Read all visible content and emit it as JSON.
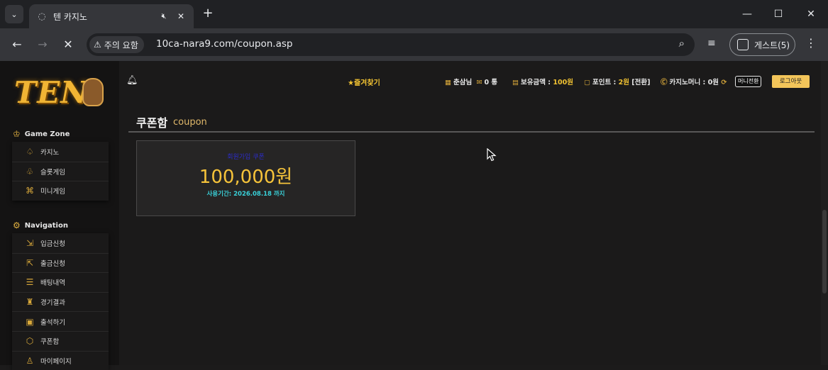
{
  "browser": {
    "tab_title": "텐 카지노",
    "url": "10ca-nara9.com/coupon.asp",
    "security_label": "주의 요함",
    "profile_label": "게스트(5)"
  },
  "sidebar": {
    "logo_text": "TEN",
    "game_zone_title": "Game Zone",
    "game_zone_items": [
      {
        "label": "카지노",
        "icon": "spade-icon"
      },
      {
        "label": "슬롯게임",
        "icon": "cherry-icon"
      },
      {
        "label": "미니게임",
        "icon": "gamepad-icon"
      }
    ],
    "navigation_title": "Navigation",
    "navigation_items": [
      {
        "label": "입금신청",
        "icon": "deposit-icon"
      },
      {
        "label": "출금신청",
        "icon": "withdraw-icon"
      },
      {
        "label": "배팅내역",
        "icon": "bet-history-icon"
      },
      {
        "label": "경기결과",
        "icon": "results-icon"
      },
      {
        "label": "출석하기",
        "icon": "attendance-icon"
      },
      {
        "label": "쿠폰함",
        "icon": "coupon-icon"
      },
      {
        "label": "마이페이지",
        "icon": "user-icon"
      }
    ]
  },
  "topbar": {
    "favorite": "★즐겨찾기",
    "user_name": "춘삼님",
    "messages": "0 통",
    "balance_label": "보유금액 :",
    "balance_value": "100원",
    "point_label": "포인트 :",
    "point_value": "2원",
    "point_convert": "[전환]",
    "casino_money_label": "카지노머니 :",
    "casino_money_value": "0원",
    "mini_convert": "머니전환",
    "logout": "로그아웃"
  },
  "main": {
    "title": "쿠폰함",
    "subtitle": "coupon",
    "coupon": {
      "name": "회원가입 쿠폰",
      "amount": "100,000원",
      "period": "사용기간: 2026.08.18 까지"
    }
  }
}
